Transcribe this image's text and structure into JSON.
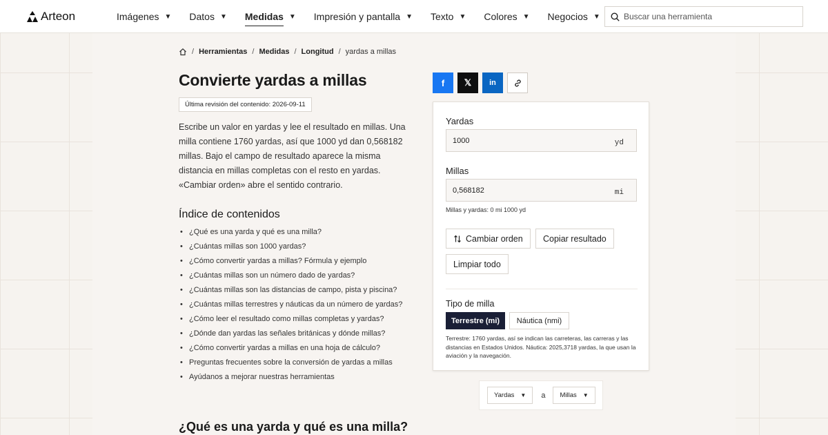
{
  "header": {
    "logo_text": "Arteon",
    "nav": [
      {
        "label": "Imágenes"
      },
      {
        "label": "Datos"
      },
      {
        "label": "Medidas",
        "active": true
      },
      {
        "label": "Impresión y pantalla"
      },
      {
        "label": "Texto"
      },
      {
        "label": "Colores"
      },
      {
        "label": "Negocios"
      }
    ],
    "search_placeholder": "Buscar una herramienta"
  },
  "breadcrumb": [
    "Herramientas",
    "Medidas",
    "Longitud",
    "yardas a millas"
  ],
  "page": {
    "title": "Convierte yardas a millas",
    "revision": "Última revisión del contenido: 2026-09-11",
    "intro": "Escribe un valor en yardas y lee el resultado en millas. Una milla contiene 1760 yardas, así que 1000 yd dan 0,568182 millas. Bajo el campo de resultado aparece la misma distancia en millas completas con el resto en yardas. «Cambiar orden» abre el sentido contrario.",
    "toc_title": "Índice de contenidos",
    "toc": [
      "¿Qué es una yarda y qué es una milla?",
      "¿Cuántas millas son 1000 yardas?",
      "¿Cómo convertir yardas a millas? Fórmula y ejemplo",
      "¿Cuántas millas son un número dado de yardas?",
      "¿Cuántas millas son las distancias de campo, pista y piscina?",
      "¿Cuántas millas terrestres y náuticas da un número de yardas?",
      "¿Cómo leer el resultado como millas completas y yardas?",
      "¿Dónde dan yardas las señales británicas y dónde millas?",
      "¿Cómo convertir yardas a millas en una hoja de cálculo?",
      "Preguntas frecuentes sobre la conversión de yardas a millas",
      "Ayúdanos a mejorar nuestras herramientas"
    ],
    "section_heading": "¿Qué es una yarda y qué es una milla?"
  },
  "share": [
    "f",
    "𝕏",
    "in",
    "link"
  ],
  "converter": {
    "from_label": "Yardas",
    "from_value": "1000",
    "from_unit": "yd",
    "to_label": "Millas",
    "to_value": "0,568182",
    "to_unit": "mi",
    "hint": "Millas y yardas: 0 mi 1000 yd",
    "swap_label": "Cambiar orden",
    "copy_label": "Copiar resultado",
    "clear_label": "Limpiar todo",
    "type_label": "Tipo de milla",
    "type_options": [
      "Terrestre (mi)",
      "Náutica (nmi)"
    ],
    "type_selected": "Terrestre (mi)",
    "note": "Terrestre: 1760 yardas, así se indican las carreteras, las carreras y las distancias en Estados Unidos. Náutica: 2025,3718 yardas, la que usan la aviación y la navegación."
  },
  "unit_selector": {
    "from": "Yardas",
    "joiner": "a",
    "to": "Millas"
  },
  "colors": {
    "accent_dark": "#1a1f36",
    "facebook": "#1877f2",
    "linkedin": "#0a66c2",
    "x": "#0f0f0f"
  }
}
